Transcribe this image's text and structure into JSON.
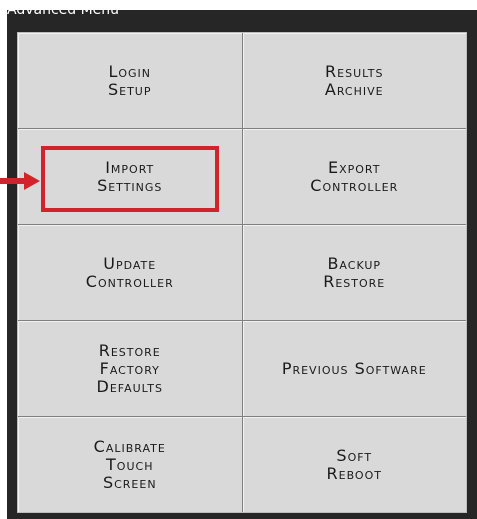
{
  "window": {
    "title": "Advanced Menu"
  },
  "menu": {
    "items": [
      {
        "line1": "Login",
        "line2": "Setup",
        "line3": ""
      },
      {
        "line1": "Results",
        "line2": "Archive",
        "line3": ""
      },
      {
        "line1": "Import",
        "line2": "Settings",
        "line3": ""
      },
      {
        "line1": "Export",
        "line2": "Controller",
        "line3": ""
      },
      {
        "line1": "Update",
        "line2": "Controller",
        "line3": ""
      },
      {
        "line1": "Backup",
        "line2": "Restore",
        "line3": ""
      },
      {
        "line1": "Restore",
        "line2": "Factory",
        "line3": "Defaults"
      },
      {
        "line1": "Previous Software",
        "line2": "",
        "line3": ""
      },
      {
        "line1": "Calibrate",
        "line2": "Touch",
        "line3": "Screen"
      },
      {
        "line1": "Soft",
        "line2": "Reboot",
        "line3": ""
      }
    ]
  },
  "annotation": {
    "color": "#d0232a",
    "icon": "arrow-right-icon"
  }
}
